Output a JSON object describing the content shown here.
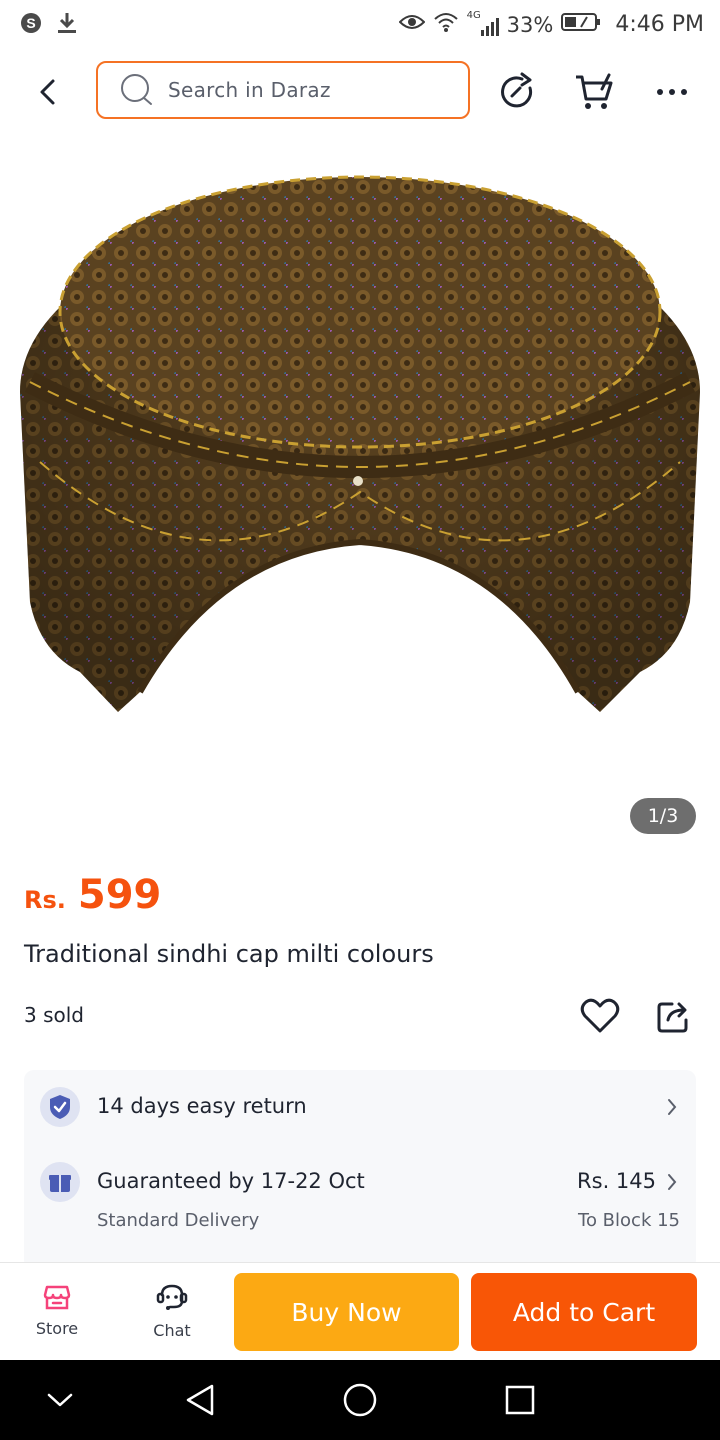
{
  "status_bar": {
    "network": "4G",
    "battery": "33%",
    "time": "4:46 PM"
  },
  "header": {
    "search_placeholder": "Search in Daraz"
  },
  "gallery": {
    "counter": "1/3"
  },
  "product": {
    "currency": "Rs.",
    "price": "599",
    "title": "Traditional sindhi cap milti colours",
    "sold": "3 sold"
  },
  "services": {
    "return_text": "14 days easy return",
    "delivery_title": "Guaranteed by 17-22 Oct",
    "delivery_type": "Standard Delivery",
    "delivery_fee": "Rs. 145",
    "delivery_location": "To Block 15"
  },
  "bottom_bar": {
    "store_label": "Store",
    "chat_label": "Chat",
    "buy_now_label": "Buy Now",
    "add_to_cart_label": "Add to Cart"
  },
  "colors": {
    "accent_orange": "#f57224",
    "price_orange": "#f5520e",
    "buy_now_yellow": "#fca913",
    "add_to_cart_orange": "#f85606"
  },
  "icons": {
    "status_left": [
      "skype-icon",
      "download-icon"
    ],
    "status_right": [
      "eye-icon",
      "wifi-icon",
      "signal-icon",
      "battery-icon"
    ],
    "header": [
      "back-arrow-icon",
      "search-icon",
      "refresh-icon",
      "cart-icon",
      "more-icon"
    ],
    "product": [
      "heart-icon",
      "share-icon"
    ],
    "services": [
      "shield-check-icon",
      "gift-icon",
      "chevron-right-icon"
    ],
    "bottom": [
      "store-icon",
      "chat-icon"
    ],
    "nav": [
      "nav-down-icon",
      "nav-back-icon",
      "nav-home-icon",
      "nav-recents-icon"
    ]
  }
}
